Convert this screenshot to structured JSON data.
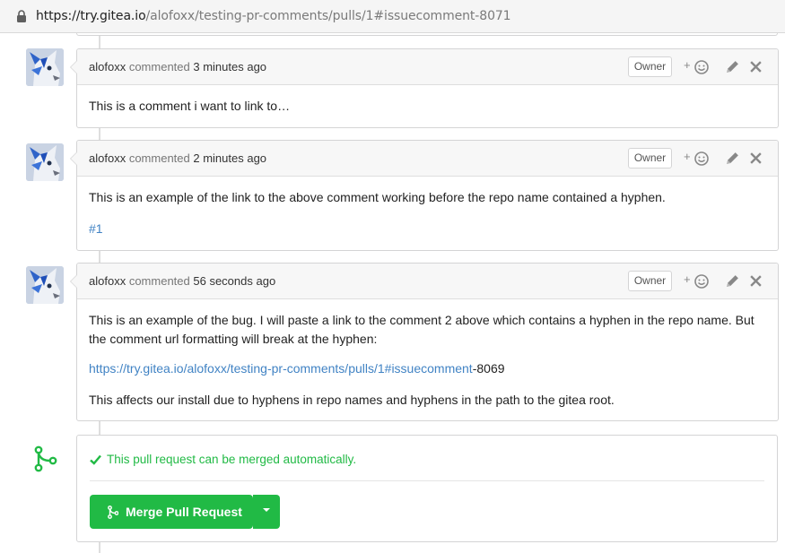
{
  "browser": {
    "url_host": "https://try.gitea.io",
    "url_path": "/alofoxx/testing-pr-comments/pulls/1#issuecomment-8071"
  },
  "comments": [
    {
      "author": "alofoxx",
      "action": "commented",
      "time": "3 minutes ago",
      "role": "Owner",
      "paragraphs": [
        "This is a comment i want to link to…"
      ]
    },
    {
      "author": "alofoxx",
      "action": "commented",
      "time": "2 minutes ago",
      "role": "Owner",
      "paragraphs": [
        "This is an example of the link to the above comment working before the repo name contained a hyphen."
      ],
      "ref_link": "#1"
    },
    {
      "author": "alofoxx",
      "action": "commented",
      "time": "56 seconds ago",
      "role": "Owner",
      "paragraphs": [
        "This is an example of the bug. I will paste a link to the comment 2 above which contains a hyphen in the repo name. But the comment url formatting will break at the hyphen:",
        "This affects our install due to hyphens in repo names and hyphens in the path to the gitea root."
      ],
      "broken_link": "https://try.gitea.io/alofoxx/testing-pr-comments/pulls/1#issuecomment",
      "broken_link_tail": "-8069"
    }
  ],
  "merge": {
    "status": "This pull request can be merged automatically.",
    "button_label": "Merge Pull Request",
    "color": "#21ba45"
  },
  "icons": {
    "lock": "lock-icon",
    "reaction": "smiley-icon",
    "edit": "pencil-icon",
    "delete": "close-icon",
    "merge": "git-merge-icon",
    "check": "check-icon",
    "dropdown": "caret-down-icon"
  }
}
